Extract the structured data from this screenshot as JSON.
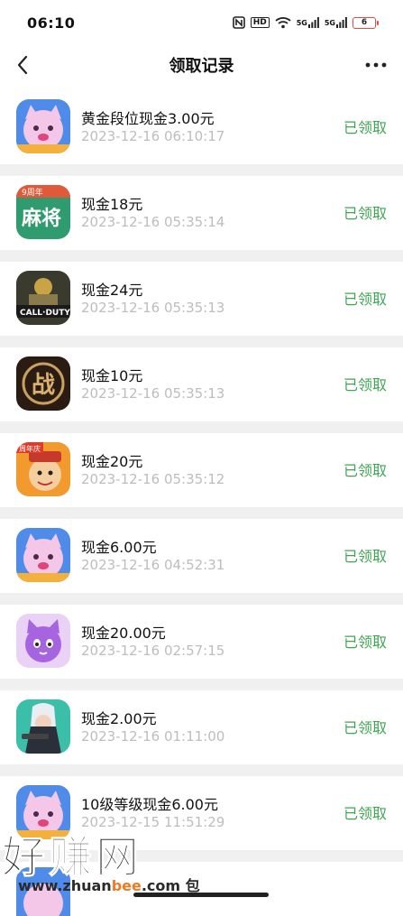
{
  "status_bar": {
    "time": "06:10",
    "network_1": "5G",
    "network_2": "5G",
    "hd": "HD",
    "battery": "6"
  },
  "header": {
    "title": "领取记录",
    "more": "•••"
  },
  "records": [
    {
      "title": "黄金段位现金3.00元",
      "time": "2023-12-16 06:10:17",
      "status": "已领取",
      "icon": "cat-game-icon"
    },
    {
      "title": "现金18元",
      "time": "2023-12-16 05:35:14",
      "status": "已领取",
      "icon": "mahjong-icon",
      "icon_badge": "9周年",
      "icon_text": "麻将"
    },
    {
      "title": "现金24元",
      "time": "2023-12-16 05:35:13",
      "status": "已领取",
      "icon": "call-of-duty-icon",
      "icon_text": "CALL·DUTY"
    },
    {
      "title": "现金10元",
      "time": "2023-12-16 05:35:13",
      "status": "已领取",
      "icon": "zhan-game-icon",
      "icon_text": "战"
    },
    {
      "title": "现金20元",
      "time": "2023-12-16 05:35:12",
      "status": "已领取",
      "icon": "card-game-icon",
      "icon_badge": "周年庆"
    },
    {
      "title": "现金6.00元",
      "time": "2023-12-16 04:52:31",
      "status": "已领取",
      "icon": "cat-game-icon"
    },
    {
      "title": "现金20.00元",
      "time": "2023-12-16 02:57:15",
      "status": "已领取",
      "icon": "purple-cat-icon"
    },
    {
      "title": "现金2.00元",
      "time": "2023-12-16 01:11:00",
      "status": "已领取",
      "icon": "shooter-game-icon"
    },
    {
      "title": "10级等级现金6.00元",
      "time": "2023-12-15 11:51:29",
      "status": "已领取",
      "icon": "cat-game-icon"
    }
  ],
  "watermark": {
    "big": "好赚网",
    "small_prefix": "www.zhuan",
    "small_mid": "bee",
    "small_suffix": ".com",
    "small_cut": "包"
  },
  "colors": {
    "status_green": "#3fa553",
    "time_gray": "#bdbdbd",
    "divider": "#f0f0f0"
  }
}
